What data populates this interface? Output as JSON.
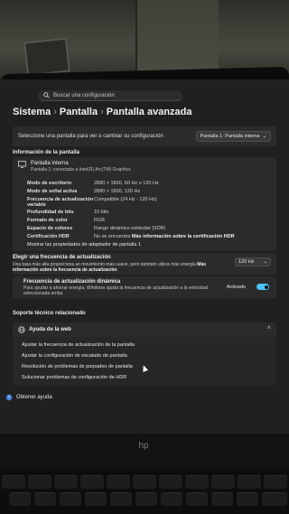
{
  "search": {
    "placeholder": "Buscar una configuración"
  },
  "breadcrumb": {
    "items": [
      "Sistema",
      "Pantalla",
      "Pantalla avanzada"
    ],
    "separator": "›"
  },
  "monitor_select": {
    "label": "Seleccione una pantalla para ver o cambiar su configuración",
    "value": "Pantalla 1: Pantalla interna"
  },
  "display_info": {
    "section_title": "Información de la pantalla",
    "display_name": "Pantalla interna",
    "display_sub": "Pantalla 1: conectada a Intel(R) Arc(TM) Graphics",
    "rows": [
      {
        "key": "Modo de escritorio",
        "value": "2880 × 1800, 60 Hz o 120 Hz"
      },
      {
        "key": "Modo de señal activa",
        "value": "2880 × 1800, 120 Hz"
      },
      {
        "key": "Frecuencia de actualización variable",
        "value": "Compatible (24 Hz - 120 Hz)"
      },
      {
        "key": "Profundidad de bits",
        "value": "10 bits"
      },
      {
        "key": "Formato de color",
        "value": "RGB"
      },
      {
        "key": "Espacio de colores",
        "value": "Rango dinámico estándar (SDR)"
      },
      {
        "key": "Certificación HDR",
        "value": "No se encuentra",
        "link": "Más información sobre la certificación HDR"
      }
    ],
    "adapter_link": "Mostrar las propiedades de adaptador de pantalla 1"
  },
  "refresh_rate": {
    "title": "Elegir una frecuencia de actualización",
    "description": "Una tasa más alta proporciona un movimiento más suave, pero también utiliza más energía",
    "more_info": "Más información sobre la frecuencia de actualización",
    "value": "120 Hz"
  },
  "dynamic_refresh": {
    "title": "Frecuencia de actualización dinámica",
    "description": "Para ayudar a ahorrar energía, Windows ajusta la frecuencia de actualización a la velocidad seleccionada arriba",
    "state": "Activado"
  },
  "support": {
    "section_title": "Soporte técnico relacionado",
    "help_title": "Ayuda de la web",
    "links": [
      "Ajustar la frecuencia de actualización de la pantalla",
      "Ajustar la configuración de escalado de pantalla",
      "Resolución de problemas de parpadeo de pantalla",
      "Solucionar problemas de configuración de HDR"
    ]
  },
  "get_help": {
    "label": "Obtener ayuda"
  },
  "hardware": {
    "logo": "hp"
  },
  "colors": {
    "accent": "#4cc2ff",
    "card": "#2b2b2b",
    "background": "#202020"
  }
}
